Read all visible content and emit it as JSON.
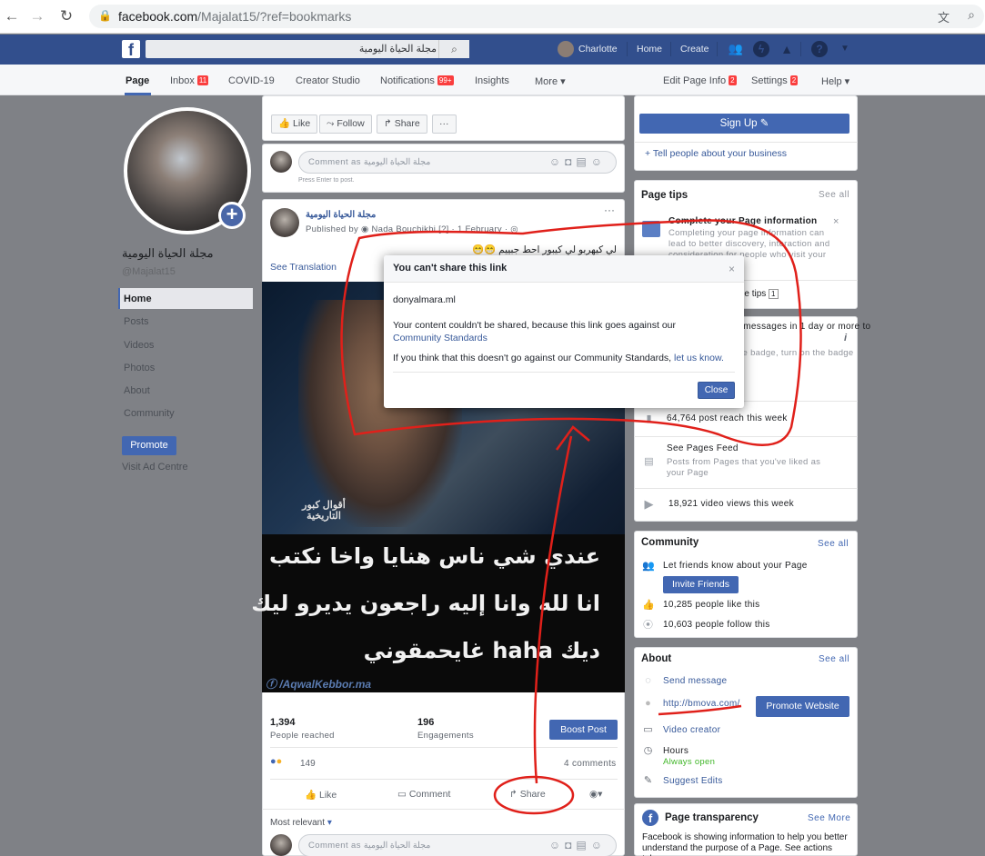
{
  "browser": {
    "url_host": "facebook.com",
    "url_path": "/Majalat15/?ref=bookmarks"
  },
  "topbar": {
    "search_value": "مجلة الحياة اليومية",
    "user_name": "Charlotte",
    "home": "Home",
    "create": "Create"
  },
  "subnav": {
    "page": "Page",
    "inbox": "Inbox",
    "inbox_badge": "11",
    "covid": "COVID-19",
    "creator": "Creator Studio",
    "notifications": "Notifications",
    "notifications_badge": "99+",
    "insights": "Insights",
    "more": "More",
    "edit_info": "Edit Page Info",
    "edit_badge": "2",
    "settings": "Settings",
    "settings_badge": "2",
    "help": "Help"
  },
  "sidebar": {
    "page_name": "مجلة الحياة اليومية",
    "handle": "@Majalat15",
    "menu": [
      "Home",
      "Posts",
      "Videos",
      "Photos",
      "About",
      "Community"
    ],
    "promote": "Promote",
    "visit_ad": "Visit Ad Centre"
  },
  "actions": {
    "like": "Like",
    "follow": "Follow",
    "share": "Share",
    "more": "···"
  },
  "comment_box": {
    "placeholder": "Comment as مجلة الحياة اليومية",
    "hint": "Press Enter to post."
  },
  "post": {
    "author": "مجلة الحياة اليومية",
    "published_by": "Published by",
    "publisher": "Nada Bouchikhi",
    "date": "1 February",
    "text": "لي كيهربو لي كيبور احط جبييم 😁😁",
    "see_translation": "See Translation",
    "image_lines": [
      "عندي شي ناس هنايا واخا نكتب",
      "انا لله وانا إليه راجعون يديرو ليك",
      "ديك haha غايحمقوني"
    ],
    "image_watermark": "/AqwalKebbor.ma",
    "image_logo": "أقوال كبور التاريخية",
    "people_reached": "1,394",
    "people_reached_label": "People reached",
    "engagements": "196",
    "engagements_label": "Engagements",
    "boost": "Boost Post",
    "reactions": "149",
    "comments": "4 comments",
    "like": "Like",
    "comment": "Comment",
    "share": "Share",
    "most_relevant": "Most relevant"
  },
  "right": {
    "sign_up": "Sign Up",
    "tell_people": "+ Tell people about your business",
    "page_tips": "Page tips",
    "see_all": "See all",
    "tip_title": "Complete your Page information",
    "tip_body": "Completing your page information can lead to better discovery, interaction and consideration for people who visit your Page now.",
    "see_page_tips": "See Page tips",
    "page_tips_count": "1",
    "respond_title": "Respond to more messages in 1 day or more to",
    "respond_sub": "earn the responsive badge, turn on the badge",
    "post_reach": "64,764 post reach this week",
    "see_pages_feed": "See Pages Feed",
    "pages_feed_sub": "Posts from Pages that you've liked as your Page",
    "video_views": "18,921 video views this week",
    "community": "Community",
    "community_see_all": "See all",
    "let_friends": "Let friends know about your Page",
    "invite": "Invite Friends",
    "likes": "10,285 people like this",
    "follows": "10,603 people follow this",
    "about": "About",
    "about_see_all": "See all",
    "send_message": "Send message",
    "website": "http://bmova.com/",
    "promote_website": "Promote Website",
    "video_creator": "Video creator",
    "hours": "Hours",
    "always_open": "Always open",
    "suggest_edits": "Suggest Edits",
    "transparency": "Page transparency",
    "see_more": "See More",
    "transparency_body": "Facebook is showing information to help you better understand the purpose of a Page. See actions taken"
  },
  "dialog": {
    "title": "You can't share this link",
    "domain": "donyalmara.ml",
    "line1": "Your content couldn't be shared, because this link goes against our",
    "link1": "Community Standards",
    "line2_pre": "If you think that this doesn't go against our Community Standards,",
    "link2": "let us know.",
    "close": "Close",
    "x": "×"
  },
  "colors": {
    "fb_blue": "#4267b2",
    "topbar": "#324f8d",
    "annotation": "#e0201a"
  }
}
